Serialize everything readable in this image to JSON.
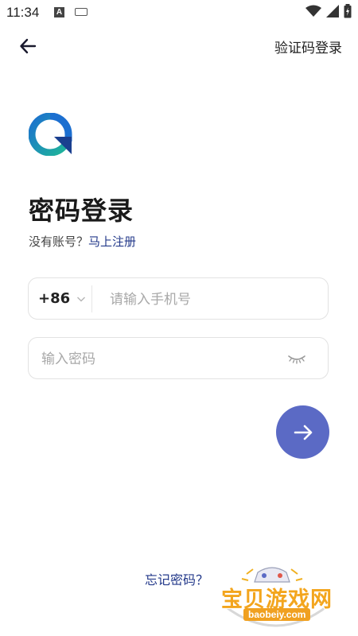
{
  "status_bar": {
    "time": "11:34",
    "a_label": "A"
  },
  "header": {
    "login_mode_link": "验证码登录"
  },
  "page": {
    "title": "密码登录",
    "no_account_text": "没有账号？",
    "register_link": "马上注册"
  },
  "phone": {
    "country_code": "+86",
    "placeholder": "请输入手机号"
  },
  "password": {
    "placeholder": "输入密码"
  },
  "forgot_link": "忘记密码？",
  "watermark": {
    "title": "宝贝游戏网",
    "url": "baobeiy.com"
  },
  "colors": {
    "accent": "#5b6ac5",
    "link": "#23398a",
    "logo_blue": "#1c6fd0",
    "logo_green": "#1fb59a"
  }
}
